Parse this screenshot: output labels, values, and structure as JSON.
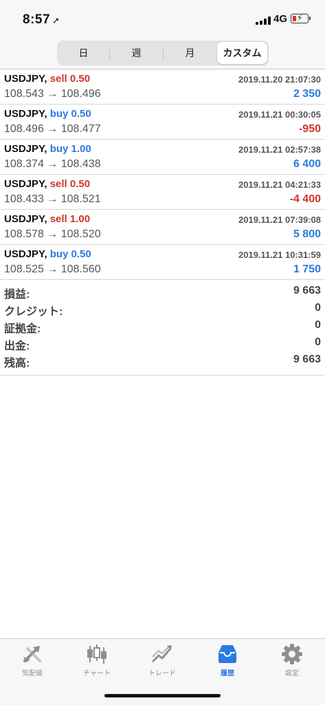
{
  "status_bar": {
    "time": "8:57",
    "network": "4G"
  },
  "period_tabs": [
    "日",
    "週",
    "月",
    "カスタム"
  ],
  "active_period": 3,
  "trades": [
    {
      "symbol": "USDJPY,",
      "side": "sell",
      "volume": "sell 0.50",
      "datetime": "2019.11.20 21:07:30",
      "open_price": "108.543",
      "close_price": "108.496",
      "profit": "2 350",
      "profit_color": "#2a7be0"
    },
    {
      "symbol": "USDJPY,",
      "side": "buy",
      "volume": "buy 0.50",
      "datetime": "2019.11.21 00:30:05",
      "open_price": "108.496",
      "close_price": "108.477",
      "profit": "-950",
      "profit_color": "#d1342a"
    },
    {
      "symbol": "USDJPY,",
      "side": "buy",
      "volume": "buy 1.00",
      "datetime": "2019.11.21 02:57:38",
      "open_price": "108.374",
      "close_price": "108.438",
      "profit": "6 400",
      "profit_color": "#2a7be0"
    },
    {
      "symbol": "USDJPY,",
      "side": "sell",
      "volume": "sell 0.50",
      "datetime": "2019.11.21 04:21:33",
      "open_price": "108.433",
      "close_price": "108.521",
      "profit": "-4 400",
      "profit_color": "#d1342a"
    },
    {
      "symbol": "USDJPY,",
      "side": "sell",
      "volume": "sell 1.00",
      "datetime": "2019.11.21 07:39:08",
      "open_price": "108.578",
      "close_price": "108.520",
      "profit": "5 800",
      "profit_color": "#2a7be0"
    },
    {
      "symbol": "USDJPY,",
      "side": "buy",
      "volume": "buy 0.50",
      "datetime": "2019.11.21 10:31:59",
      "open_price": "108.525",
      "close_price": "108.560",
      "profit": "1 750",
      "profit_color": "#2a7be0"
    }
  ],
  "price_arrow": "→",
  "summary": [
    {
      "label": "損益:",
      "value": "9 663"
    },
    {
      "label": "クレジット:",
      "value": "0"
    },
    {
      "label": "証拠金:",
      "value": "0"
    },
    {
      "label": "出金:",
      "value": "0"
    },
    {
      "label": "残高:",
      "value": "9 663"
    }
  ],
  "tabbar": [
    {
      "label": "気配値",
      "icon": "quotes-icon"
    },
    {
      "label": "チャート",
      "icon": "candlestick-chart-icon"
    },
    {
      "label": "トレード",
      "icon": "trade-trend-icon"
    },
    {
      "label": "履歴",
      "icon": "history-inbox-icon",
      "active": true
    },
    {
      "label": "設定",
      "icon": "gear-icon"
    }
  ],
  "colors": {
    "sell": "#d1342a",
    "buy": "#2a7be0",
    "accent": "#2a7be0",
    "inactive": "#8e8e93"
  }
}
